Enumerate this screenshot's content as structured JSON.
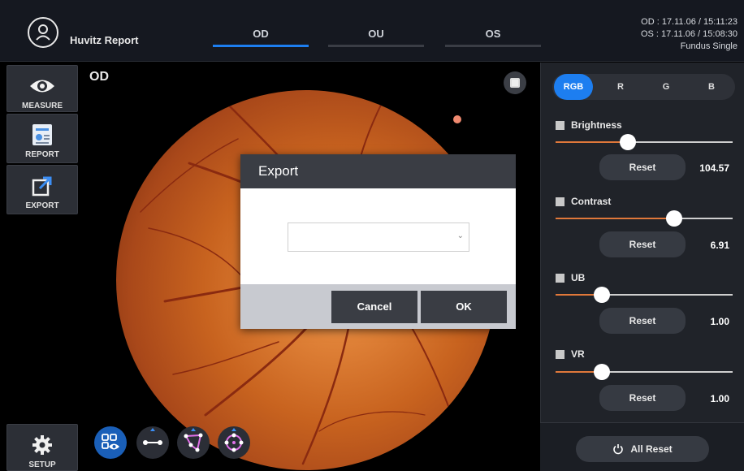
{
  "header": {
    "app_title": "Huvitz Report",
    "tabs": [
      {
        "label": "OD",
        "active": true
      },
      {
        "label": "OU",
        "active": false
      },
      {
        "label": "OS",
        "active": false
      }
    ],
    "info_lines": [
      "OD : 17.11.06 / 15:11:23",
      "OS : 17.11.06 / 15:08:30",
      "Fundus Single"
    ]
  },
  "toolbar": {
    "measure_label": "MEASURE",
    "report_label": "REPORT",
    "export_label": "EXPORT",
    "setup_label": "SETUP"
  },
  "viewer": {
    "eye_label": "OD",
    "tools": [
      "eye-view-icon",
      "line-measure-icon",
      "polygon-measure-icon",
      "circle-measure-icon"
    ]
  },
  "panel": {
    "channels": [
      "RGB",
      "R",
      "G",
      "B"
    ],
    "active_channel": "RGB",
    "adjustments": [
      {
        "name": "Brightness",
        "value": "104.57",
        "level": 0.41
      },
      {
        "name": "Contrast",
        "value": "6.91",
        "level": 0.67
      },
      {
        "name": "UB",
        "value": "1.00",
        "level": 0.26
      },
      {
        "name": "VR",
        "value": "1.00",
        "level": 0.26
      }
    ],
    "reset_label": "Reset",
    "all_reset_label": "All Reset"
  },
  "dialog": {
    "title": "Export",
    "select_value": "",
    "cancel_label": "Cancel",
    "ok_label": "OK"
  },
  "colors": {
    "accent": "#1d7ef0",
    "slider_fill": "#e0783a"
  }
}
